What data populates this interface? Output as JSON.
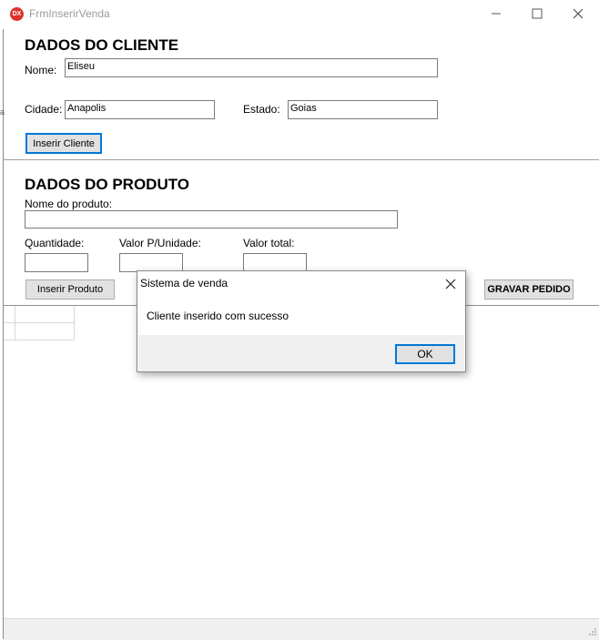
{
  "window": {
    "title": "FrmInserirVenda",
    "app_icon_text": "DX"
  },
  "cliente": {
    "section_title": "DADOS DO CLIENTE",
    "nome_label": "Nome:",
    "nome_value": "Eliseu",
    "cidade_label": "Cidade:",
    "cidade_value": "Anapolis",
    "estado_label": "Estado:",
    "estado_value": "Goias",
    "inserir_button": "Inserir Cliente"
  },
  "produto": {
    "section_title": "DADOS DO PRODUTO",
    "nome_label": "Nome do produto:",
    "nome_value": "",
    "quantidade_label": "Quantidade:",
    "quantidade_value": "",
    "valor_unidade_label": "Valor P/Unidade:",
    "valor_unidade_value": "",
    "valor_total_label": "Valor total:",
    "valor_total_value": "",
    "inserir_button": "Inserir Produto",
    "gravar_button": "GRAVAR PEDIDO"
  },
  "dialog": {
    "title": "Sistema de venda",
    "message": "Cliente inserido com sucesso",
    "ok_label": "OK"
  },
  "colors": {
    "accent": "#0078d7",
    "icon_red": "#d9342b"
  }
}
